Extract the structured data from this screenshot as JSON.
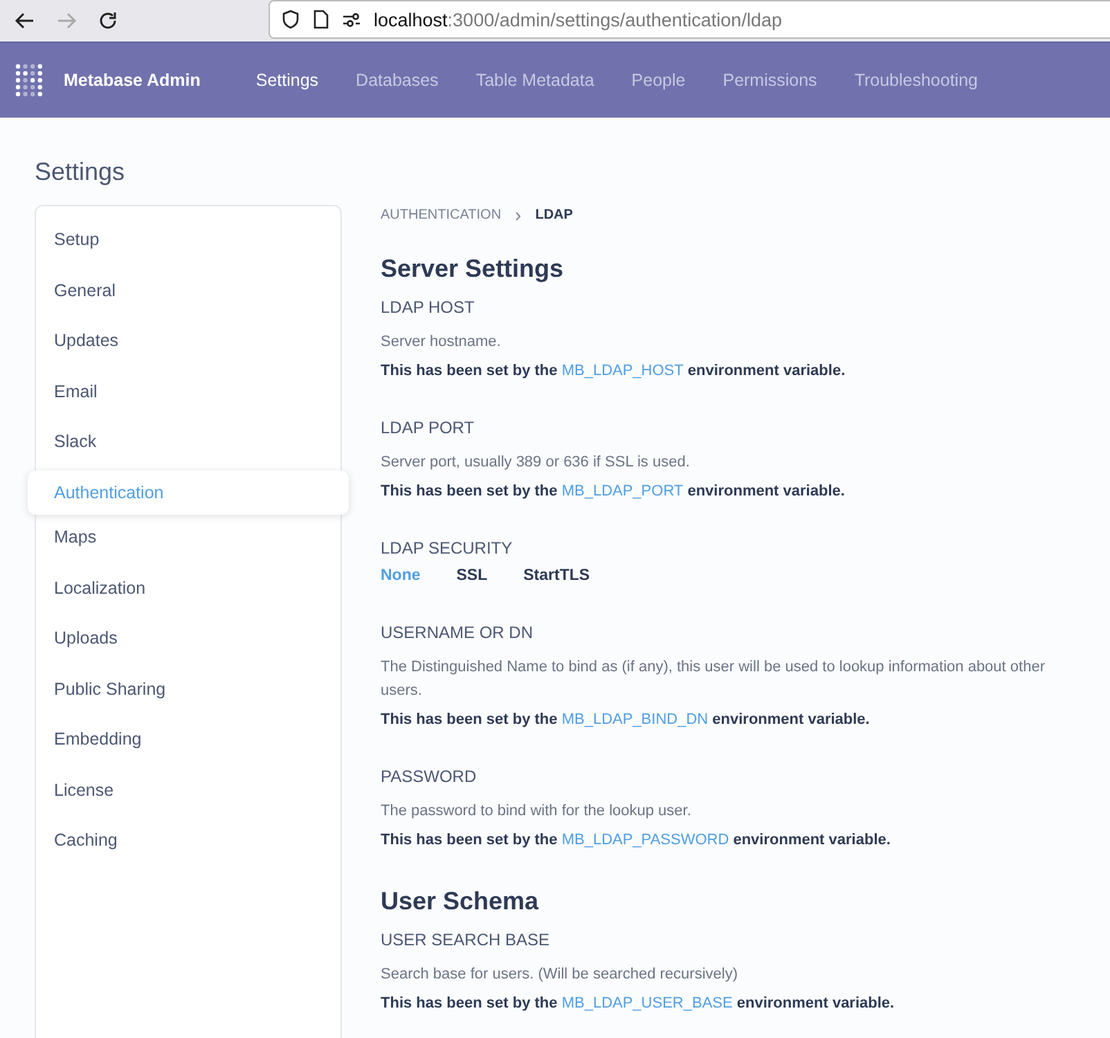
{
  "browser": {
    "url_host": "localhost",
    "url_path": ":3000/admin/settings/authentication/ldap",
    "back_disabled": false,
    "forward_disabled": true
  },
  "nav": {
    "brand": "Metabase Admin",
    "items": [
      {
        "label": "Settings",
        "selected": true
      },
      {
        "label": "Databases",
        "selected": false
      },
      {
        "label": "Table Metadata",
        "selected": false
      },
      {
        "label": "People",
        "selected": false
      },
      {
        "label": "Permissions",
        "selected": false
      },
      {
        "label": "Troubleshooting",
        "selected": false
      }
    ]
  },
  "page_title": "Settings",
  "sidebar": {
    "items": [
      {
        "label": "Setup",
        "selected": false
      },
      {
        "label": "General",
        "selected": false
      },
      {
        "label": "Updates",
        "selected": false
      },
      {
        "label": "Email",
        "selected": false
      },
      {
        "label": "Slack",
        "selected": false
      },
      {
        "label": "Authentication",
        "selected": true
      },
      {
        "label": "Maps",
        "selected": false
      },
      {
        "label": "Localization",
        "selected": false
      },
      {
        "label": "Uploads",
        "selected": false
      },
      {
        "label": "Public Sharing",
        "selected": false
      },
      {
        "label": "Embedding",
        "selected": false
      },
      {
        "label": "License",
        "selected": false
      },
      {
        "label": "Caching",
        "selected": false
      }
    ]
  },
  "breadcrumb": {
    "parent": "AUTHENTICATION",
    "separator": "›",
    "current": "LDAP"
  },
  "sections": [
    {
      "kind": "heading",
      "title": "Server Settings"
    },
    {
      "kind": "setting",
      "label": "LDAP HOST",
      "description": "Server hostname.",
      "note_before": "This has been set by the ",
      "variable": "MB_LDAP_HOST",
      "note_after": " environment variable."
    },
    {
      "kind": "setting",
      "label": "LDAP PORT",
      "description": "Server port, usually 389 or 636 if SSL is used.",
      "note_before": "This has been set by the ",
      "variable": "MB_LDAP_PORT",
      "note_after": " environment variable."
    },
    {
      "kind": "options",
      "label": "LDAP SECURITY",
      "options": [
        {
          "label": "None",
          "selected": true
        },
        {
          "label": "SSL",
          "selected": false
        },
        {
          "label": "StartTLS",
          "selected": false
        }
      ]
    },
    {
      "kind": "setting",
      "label": "USERNAME OR DN",
      "description": "The Distinguished Name to bind as (if any), this user will be used to lookup information about other users.",
      "note_before": "This has been set by the ",
      "variable": "MB_LDAP_BIND_DN",
      "note_after": " environment variable."
    },
    {
      "kind": "setting",
      "label": "PASSWORD",
      "description": "The password to bind with for the lookup user.",
      "note_before": "This has been set by the ",
      "variable": "MB_LDAP_PASSWORD",
      "note_after": " environment variable."
    },
    {
      "kind": "heading",
      "title": "User Schema"
    },
    {
      "kind": "setting",
      "label": "USER SEARCH BASE",
      "description": "Search base for users. (Will be searched recursively)",
      "note_before": "This has been set by the ",
      "variable": "MB_LDAP_USER_BASE",
      "note_after": " environment variable."
    }
  ]
}
